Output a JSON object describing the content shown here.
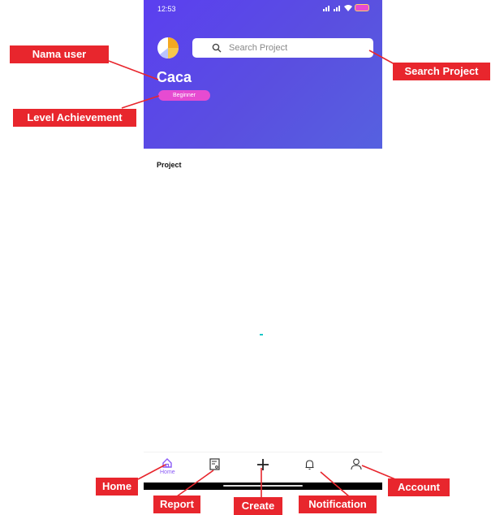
{
  "status": {
    "time": "12:53",
    "battery": ""
  },
  "search": {
    "placeholder": "Search Project"
  },
  "user": {
    "name": "Caca",
    "level": "Beginner"
  },
  "project": {
    "title": "Project"
  },
  "nav": {
    "home_label": "Home",
    "items": [
      "home-icon",
      "report-icon",
      "add-icon",
      "bell-icon",
      "user-icon"
    ]
  },
  "annotations": {
    "nama_user": "Nama user",
    "level_achievement": "Level Achievement",
    "search_project": "Search Project",
    "home": "Home",
    "report": "Report",
    "create": "Create",
    "notification": "Notification",
    "account": "Account"
  },
  "colors": {
    "header_start": "#5b3ff0",
    "header_end": "#5661e0",
    "badge": "#e64bd1",
    "accent": "#8b5cf6",
    "callout": "#e8262d"
  }
}
